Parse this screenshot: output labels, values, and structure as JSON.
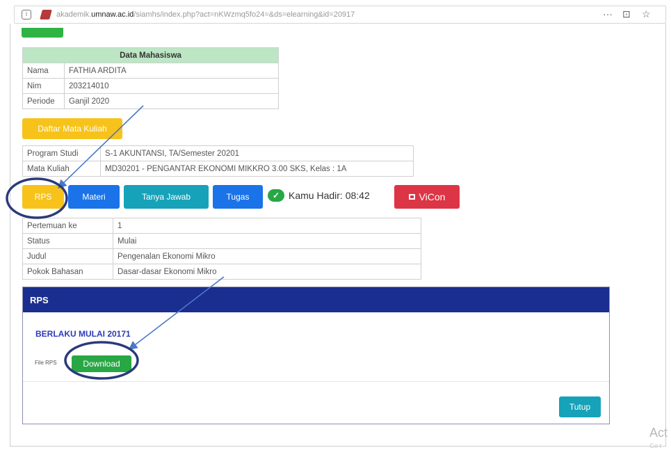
{
  "browser": {
    "url_prefix": "akademik.",
    "url_host": "umnaw.ac.id",
    "url_path": "/siamhs/index.php?act=nKWzmq5fo24=&ds=elearning&id=20917",
    "menu_icon": "···",
    "pocket_icon": "⊡",
    "bookmark_icon": "☆"
  },
  "mahasiswa": {
    "header": "Data Mahasiswa",
    "rows": [
      {
        "label": "Nama",
        "value": "FATHIA ARDITA"
      },
      {
        "label": "Nim",
        "value": "203214010"
      },
      {
        "label": "Periode",
        "value": "Ganjil 2020"
      }
    ]
  },
  "daftar_button": "Daftar Mata Kuliah",
  "prodi": {
    "rows": [
      {
        "label": "Program Studi",
        "value": "S-1 AKUNTANSI, TA/Semester 20201"
      },
      {
        "label": "Mata Kuliah",
        "value": "MD30201 - PENGANTAR EKONOMI MIKKRO 3.00 SKS, Kelas : 1A"
      }
    ]
  },
  "actions": {
    "rps": "RPS",
    "materi": "Materi",
    "tanya_jawab": "Tanya Jawab",
    "tugas": "Tugas",
    "hadir": "Kamu Hadir: 08:42",
    "vicon": "ViCon"
  },
  "pertemuan": {
    "rows": [
      {
        "label": "Pertemuan ke",
        "value": "1"
      },
      {
        "label": "Status",
        "value": "Mulai"
      },
      {
        "label": "Judul",
        "value": "Pengenalan Ekonomi Mikro"
      },
      {
        "label": "Pokok Bahasan",
        "value": "Dasar-dasar Ekonomi Mikro"
      }
    ]
  },
  "modal": {
    "title": "RPS",
    "subtitle": "BERLAKU MULAI 20171",
    "file_label": "File RPS",
    "download": "Download",
    "tutup": "Tutup"
  },
  "watermark": {
    "line1": "Act",
    "line2": "Go t"
  },
  "colors": {
    "annotation": "#2b3a7a",
    "arrow": "#4a78c8"
  }
}
